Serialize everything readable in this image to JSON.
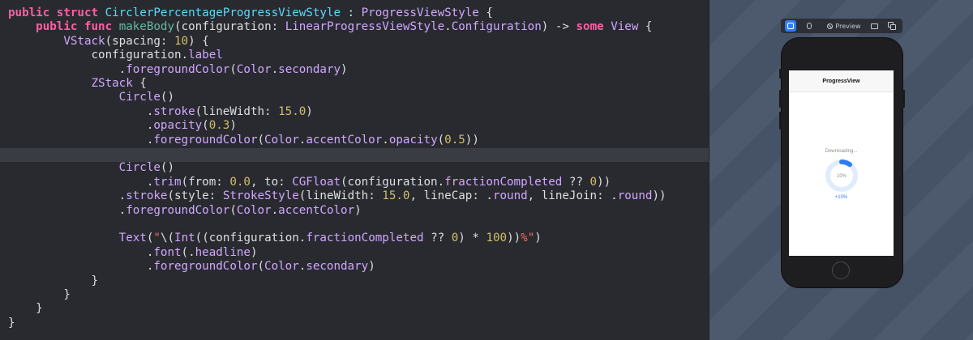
{
  "editor": {
    "lines": [
      [
        [
          "kw",
          "public"
        ],
        [
          "p",
          " "
        ],
        [
          "kw",
          "struct"
        ],
        [
          "p",
          " "
        ],
        [
          "type",
          "CirclerPercentageProgressViewStyle"
        ],
        [
          "p",
          " : "
        ],
        [
          "ts",
          "ProgressViewStyle"
        ],
        [
          "p",
          " {"
        ]
      ],
      [
        [
          "p",
          "    "
        ],
        [
          "kw",
          "public"
        ],
        [
          "p",
          " "
        ],
        [
          "kw",
          "func"
        ],
        [
          "p",
          " "
        ],
        [
          "fn",
          "makeBody"
        ],
        [
          "p",
          "(configuration: "
        ],
        [
          "ts",
          "LinearProgressViewStyle"
        ],
        [
          "p",
          "."
        ],
        [
          "ts",
          "Configuration"
        ],
        [
          "p",
          ") -> "
        ],
        [
          "kw",
          "some"
        ],
        [
          "p",
          " "
        ],
        [
          "ts",
          "View"
        ],
        [
          "p",
          " {"
        ]
      ],
      [
        [
          "p",
          "        "
        ],
        [
          "ts",
          "VStack"
        ],
        [
          "p",
          "(spacing: "
        ],
        [
          "num",
          "10"
        ],
        [
          "p",
          ") {"
        ]
      ],
      [
        [
          "p",
          "            configuration."
        ],
        [
          "sys",
          "label"
        ]
      ],
      [
        [
          "p",
          "                ."
        ],
        [
          "sys",
          "foregroundColor"
        ],
        [
          "p",
          "("
        ],
        [
          "ts",
          "Color"
        ],
        [
          "p",
          "."
        ],
        [
          "sys",
          "secondary"
        ],
        [
          "p",
          ")"
        ]
      ],
      [
        [
          "p",
          "            "
        ],
        [
          "ts",
          "ZStack"
        ],
        [
          "p",
          " {"
        ]
      ],
      [
        [
          "p",
          "                "
        ],
        [
          "ts",
          "Circle"
        ],
        [
          "p",
          "()"
        ]
      ],
      [
        [
          "p",
          "                    ."
        ],
        [
          "sys",
          "stroke"
        ],
        [
          "p",
          "(lineWidth: "
        ],
        [
          "num",
          "15.0"
        ],
        [
          "p",
          ")"
        ]
      ],
      [
        [
          "p",
          "                    ."
        ],
        [
          "sys",
          "opacity"
        ],
        [
          "p",
          "("
        ],
        [
          "num",
          "0.3"
        ],
        [
          "p",
          ")"
        ]
      ],
      [
        [
          "p",
          "                    ."
        ],
        [
          "sys",
          "foregroundColor"
        ],
        [
          "p",
          "("
        ],
        [
          "ts",
          "Color"
        ],
        [
          "p",
          "."
        ],
        [
          "sys",
          "accentColor"
        ],
        [
          "p",
          "."
        ],
        [
          "sys",
          "opacity"
        ],
        [
          "p",
          "("
        ],
        [
          "num",
          "0.5"
        ],
        [
          "p",
          "))"
        ]
      ],
      [
        [
          "p",
          ""
        ]
      ],
      [
        [
          "p",
          "                "
        ],
        [
          "ts",
          "Circle"
        ],
        [
          "p",
          "()"
        ]
      ],
      [
        [
          "p",
          "                    ."
        ],
        [
          "sys",
          "trim"
        ],
        [
          "p",
          "(from: "
        ],
        [
          "num",
          "0.0"
        ],
        [
          "p",
          ", to: "
        ],
        [
          "ts",
          "CGFloat"
        ],
        [
          "p",
          "(configuration."
        ],
        [
          "sys",
          "fractionCompleted"
        ],
        [
          "p",
          " ?? "
        ],
        [
          "num",
          "0"
        ],
        [
          "p",
          "))"
        ]
      ],
      [
        [
          "p",
          "                ."
        ],
        [
          "sys",
          "stroke"
        ],
        [
          "p",
          "(style: "
        ],
        [
          "ts",
          "StrokeStyle"
        ],
        [
          "p",
          "(lineWidth: "
        ],
        [
          "num",
          "15.0"
        ],
        [
          "p",
          ", lineCap: ."
        ],
        [
          "sys",
          "round"
        ],
        [
          "p",
          ", lineJoin: ."
        ],
        [
          "sys",
          "round"
        ],
        [
          "p",
          "))"
        ]
      ],
      [
        [
          "p",
          "                ."
        ],
        [
          "sys",
          "foregroundColor"
        ],
        [
          "p",
          "("
        ],
        [
          "ts",
          "Color"
        ],
        [
          "p",
          "."
        ],
        [
          "sys",
          "accentColor"
        ],
        [
          "p",
          ")"
        ]
      ],
      [
        [
          "p",
          ""
        ]
      ],
      [
        [
          "p",
          "                "
        ],
        [
          "ts",
          "Text"
        ],
        [
          "p",
          "("
        ],
        [
          "str",
          "\""
        ],
        [
          "p",
          "\\("
        ],
        [
          "ts",
          "Int"
        ],
        [
          "p",
          "((configuration."
        ],
        [
          "sys",
          "fractionCompleted"
        ],
        [
          "p",
          " ?? "
        ],
        [
          "num",
          "0"
        ],
        [
          "p",
          ") * "
        ],
        [
          "num",
          "100"
        ],
        [
          "p",
          "))"
        ],
        [
          "str",
          "%\""
        ],
        [
          "p",
          ")"
        ]
      ],
      [
        [
          "p",
          "                    ."
        ],
        [
          "sys",
          "font"
        ],
        [
          "p",
          "(."
        ],
        [
          "sys",
          "headline"
        ],
        [
          "p",
          ")"
        ]
      ],
      [
        [
          "p",
          "                    ."
        ],
        [
          "sys",
          "foregroundColor"
        ],
        [
          "p",
          "("
        ],
        [
          "ts",
          "Color"
        ],
        [
          "p",
          "."
        ],
        [
          "sys",
          "secondary"
        ],
        [
          "p",
          ")"
        ]
      ],
      [
        [
          "p",
          "            }"
        ]
      ],
      [
        [
          "p",
          "        }"
        ]
      ],
      [
        [
          "p",
          "    }"
        ]
      ],
      [
        [
          "p",
          "}"
        ]
      ]
    ]
  },
  "preview_bar": {
    "preview_label": "Preview"
  },
  "simulator": {
    "nav_title": "ProgressView",
    "progress_label": "Downloading...",
    "progress_value": 0.1,
    "percent_text": "10%",
    "increment_button": "+10%",
    "accent_color": "#2f7df6"
  }
}
